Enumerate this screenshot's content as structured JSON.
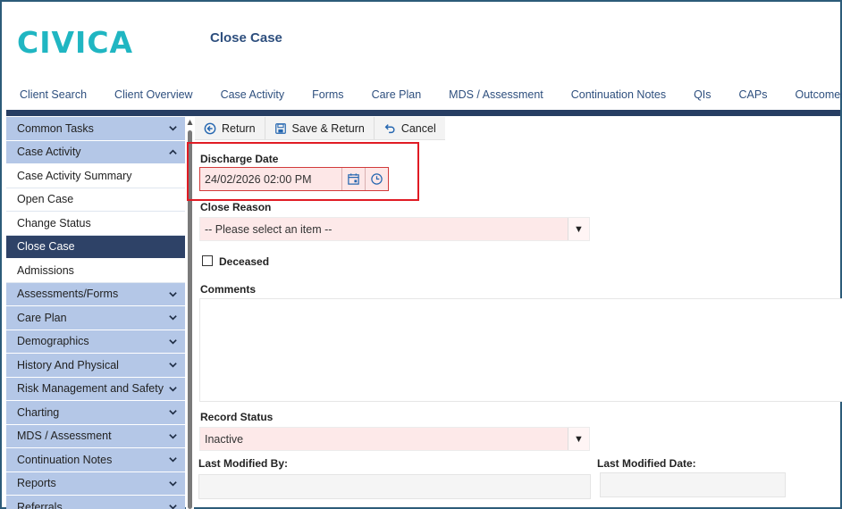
{
  "app": {
    "logo": "CIVICA",
    "page_title": "Close Case"
  },
  "nav": {
    "tabs": [
      "Client Search",
      "Client Overview",
      "Case Activity",
      "Forms",
      "Care Plan",
      "MDS / Assessment",
      "Continuation Notes",
      "QIs",
      "CAPs",
      "Outcomes"
    ]
  },
  "sidebar": {
    "items": [
      {
        "label": "Common Tasks",
        "type": "group",
        "chevron": "down"
      },
      {
        "label": "Case Activity",
        "type": "group",
        "chevron": "up"
      },
      {
        "label": "Case Activity Summary",
        "type": "sub"
      },
      {
        "label": "Open Case",
        "type": "sub"
      },
      {
        "label": "Change Status",
        "type": "sub"
      },
      {
        "label": "Close Case",
        "type": "active"
      },
      {
        "label": "Admissions",
        "type": "sub"
      },
      {
        "label": "Assessments/Forms",
        "type": "group",
        "chevron": "down"
      },
      {
        "label": "Care Plan",
        "type": "group",
        "chevron": "down"
      },
      {
        "label": "Demographics",
        "type": "group",
        "chevron": "down"
      },
      {
        "label": "History And Physical",
        "type": "group",
        "chevron": "down"
      },
      {
        "label": "Risk Management and Safety",
        "type": "group",
        "chevron": "down"
      },
      {
        "label": "Charting",
        "type": "group",
        "chevron": "down"
      },
      {
        "label": "MDS / Assessment",
        "type": "group",
        "chevron": "down"
      },
      {
        "label": "Continuation Notes",
        "type": "group",
        "chevron": "down"
      },
      {
        "label": "Reports",
        "type": "group",
        "chevron": "down"
      },
      {
        "label": "Referrals",
        "type": "group",
        "chevron": "down"
      }
    ]
  },
  "toolbar": {
    "return_label": "Return",
    "save_return_label": "Save & Return",
    "cancel_label": "Cancel"
  },
  "form": {
    "discharge_date_label": "Discharge Date",
    "discharge_date_value": "24/02/2026 02:00 PM",
    "close_reason_label": "Close Reason",
    "close_reason_value": "-- Please select an item --",
    "deceased_label": "Deceased",
    "deceased_checked": false,
    "comments_label": "Comments",
    "comments_value": "",
    "record_status_label": "Record Status",
    "record_status_value": "Inactive",
    "last_modified_by_label": "Last Modified By:",
    "last_modified_by_value": "",
    "last_modified_date_label": "Last Modified Date:",
    "last_modified_date_value": ""
  },
  "colors": {
    "brand": "#20b6c2",
    "nav_bar": "#273e63",
    "sidebar_group": "#b4c7e7",
    "sidebar_active": "#2e4267",
    "required_field": "#fde7e7",
    "highlight": "#e01b24"
  }
}
